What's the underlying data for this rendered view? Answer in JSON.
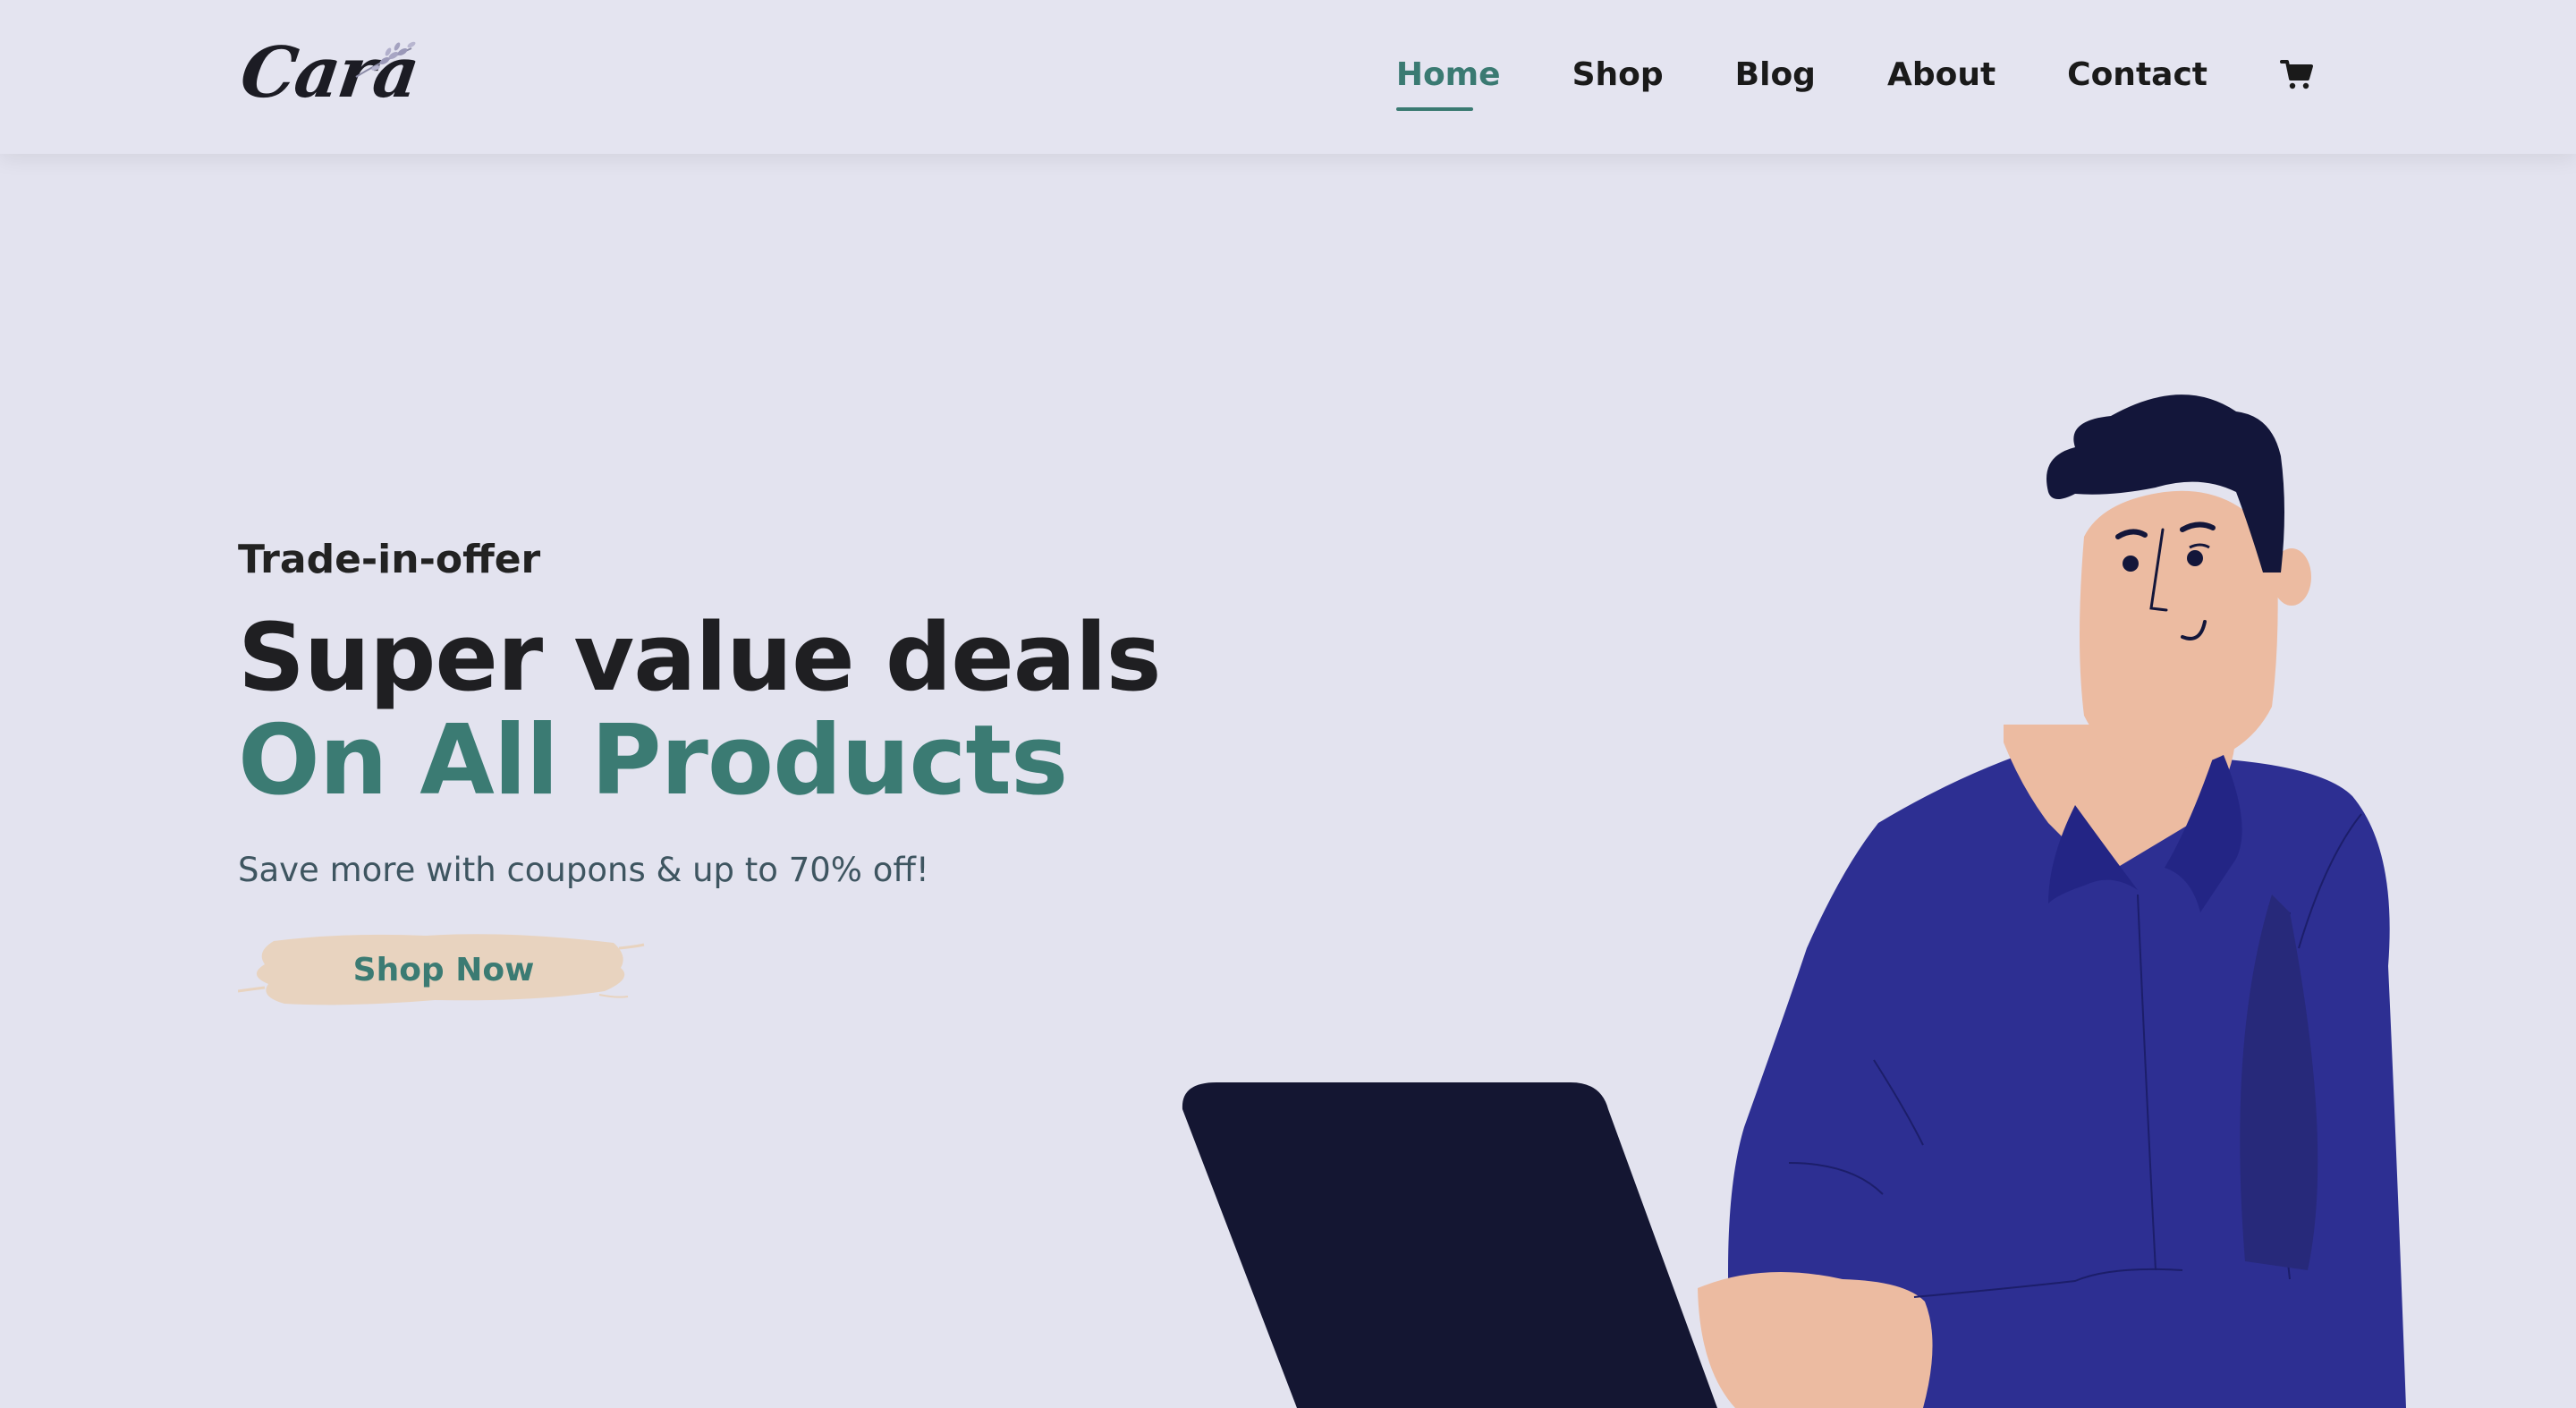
{
  "brand": {
    "logo_text": "Cara"
  },
  "nav": {
    "items": [
      {
        "label": "Home",
        "active": true
      },
      {
        "label": "Shop",
        "active": false
      },
      {
        "label": "Blog",
        "active": false
      },
      {
        "label": "About",
        "active": false
      },
      {
        "label": "Contact",
        "active": false
      }
    ],
    "cart_icon": "shopping-cart-icon"
  },
  "hero": {
    "eyebrow": "Trade-in-offer",
    "headline": "Super value deals",
    "headline_accent": "On All Products",
    "subtext": "Save more with coupons & up to 70% off!",
    "cta_label": "Shop Now"
  },
  "colors": {
    "background": "#e3e3ef",
    "accent": "#3b7b73",
    "cta_brush": "#e8d3bf",
    "shirt": "#2d2f92",
    "laptop": "#141632",
    "skin": "#ecbba1"
  }
}
